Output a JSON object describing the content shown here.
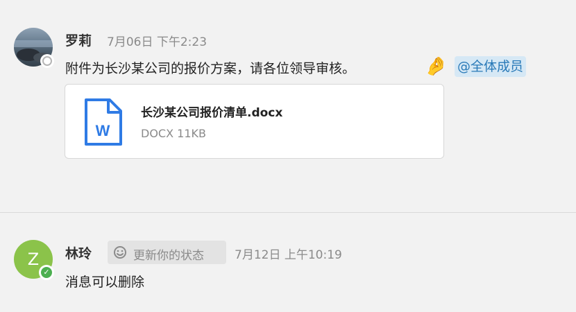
{
  "messages": [
    {
      "sender": "罗莉",
      "timestamp": "7月06日 下午2:23",
      "text": "附件为长沙某公司的报价方案，请各位领导审核。",
      "emoji": "🤌",
      "mention": "@全体成员",
      "presence": "offline",
      "attachment": {
        "file_name": "长沙某公司报价清单.docx",
        "file_type": "DOCX",
        "file_size": "11KB",
        "icon_letter": "W",
        "icon_color": "#2f7be5"
      }
    },
    {
      "sender": "林玲",
      "avatar_letter": "Z",
      "avatar_color": "#8bc34a",
      "status_label": "更新你的状态",
      "timestamp": "7月12日 上午10:19",
      "text": "消息可以删除",
      "presence": "online",
      "presence_color": "#4caf50"
    }
  ]
}
